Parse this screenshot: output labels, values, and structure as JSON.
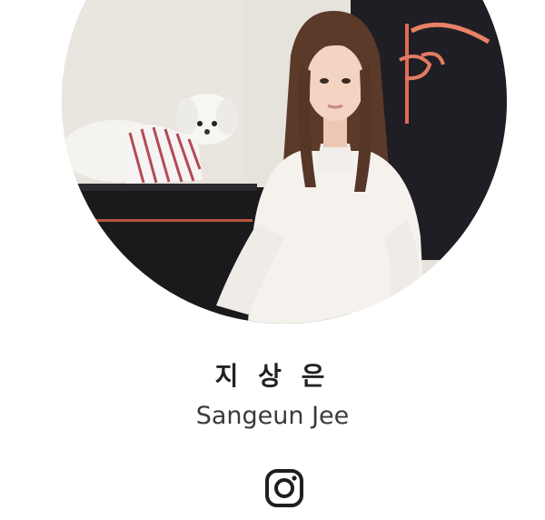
{
  "profile": {
    "name_native": "지 상 은",
    "name_latin": "Sangeun Jee",
    "photo_alt": "Sangeun Jee profile photo"
  },
  "social": {
    "links": [
      {
        "icon": "instagram-icon",
        "label": "Instagram"
      }
    ]
  },
  "colors": {
    "background": "#ffffff",
    "name_native": "#222222",
    "name_latin": "#3a3a3a",
    "icon": "#1f1f1f"
  }
}
